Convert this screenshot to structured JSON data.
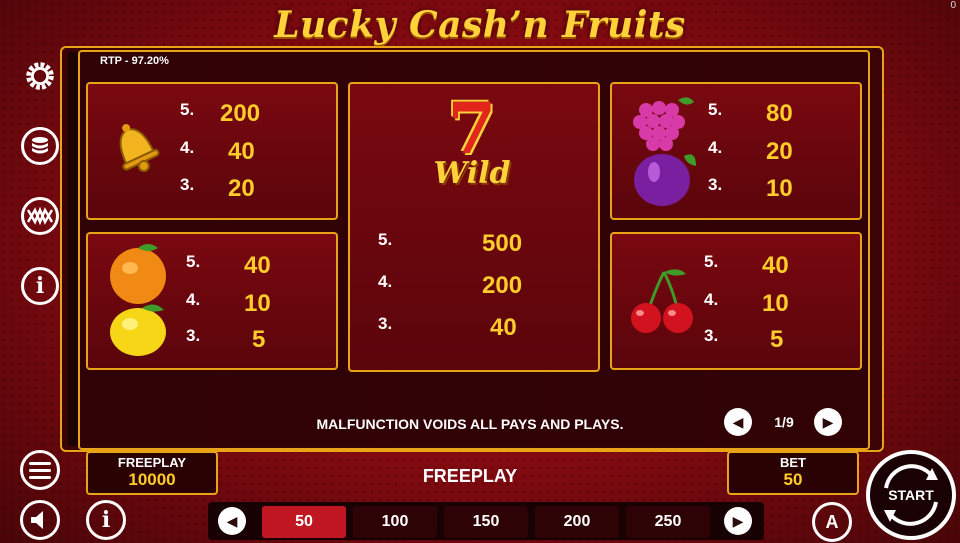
{
  "title": "Lucky Cash’n Fruits",
  "corner_count": "0",
  "rtp": "RTP - 97.20%",
  "paytable": {
    "bell": [
      {
        "m": "5.",
        "p": "200"
      },
      {
        "m": "4.",
        "p": "40"
      },
      {
        "m": "3.",
        "p": "20"
      }
    ],
    "wild": [
      {
        "m": "5.",
        "p": "500"
      },
      {
        "m": "4.",
        "p": "200"
      },
      {
        "m": "3.",
        "p": "40"
      }
    ],
    "grapes_plum": [
      {
        "m": "5.",
        "p": "80"
      },
      {
        "m": "4.",
        "p": "20"
      },
      {
        "m": "3.",
        "p": "10"
      }
    ],
    "orange_lemon": [
      {
        "m": "5.",
        "p": "40"
      },
      {
        "m": "4.",
        "p": "10"
      },
      {
        "m": "3.",
        "p": "5"
      }
    ],
    "cherry": [
      {
        "m": "5.",
        "p": "40"
      },
      {
        "m": "4.",
        "p": "10"
      },
      {
        "m": "3.",
        "p": "5"
      }
    ],
    "wild_label": "Wild",
    "seven": "7"
  },
  "malfunction": "MALFUNCTION VOIDS ALL PAYS AND PLAYS.",
  "page_indicator": "1/9",
  "freeplay_box": {
    "label": "FREEPLAY",
    "value": "10000"
  },
  "center_label": "FREEPLAY",
  "bet_box": {
    "label": "BET",
    "value": "50"
  },
  "bet_options": [
    "50",
    "100",
    "150",
    "200",
    "250"
  ],
  "selected_bet": "50",
  "start_label": "START",
  "auto_label": "A",
  "colors": {
    "gold": "#e8a317",
    "payout": "#ffcc2a",
    "selected": "#c11722"
  },
  "icons": [
    "gear-icon",
    "coins-icon",
    "lines-icon",
    "info-icon",
    "menu-icon",
    "sound-icon",
    "info-icon",
    "autoplay-icon",
    "start-icon"
  ]
}
